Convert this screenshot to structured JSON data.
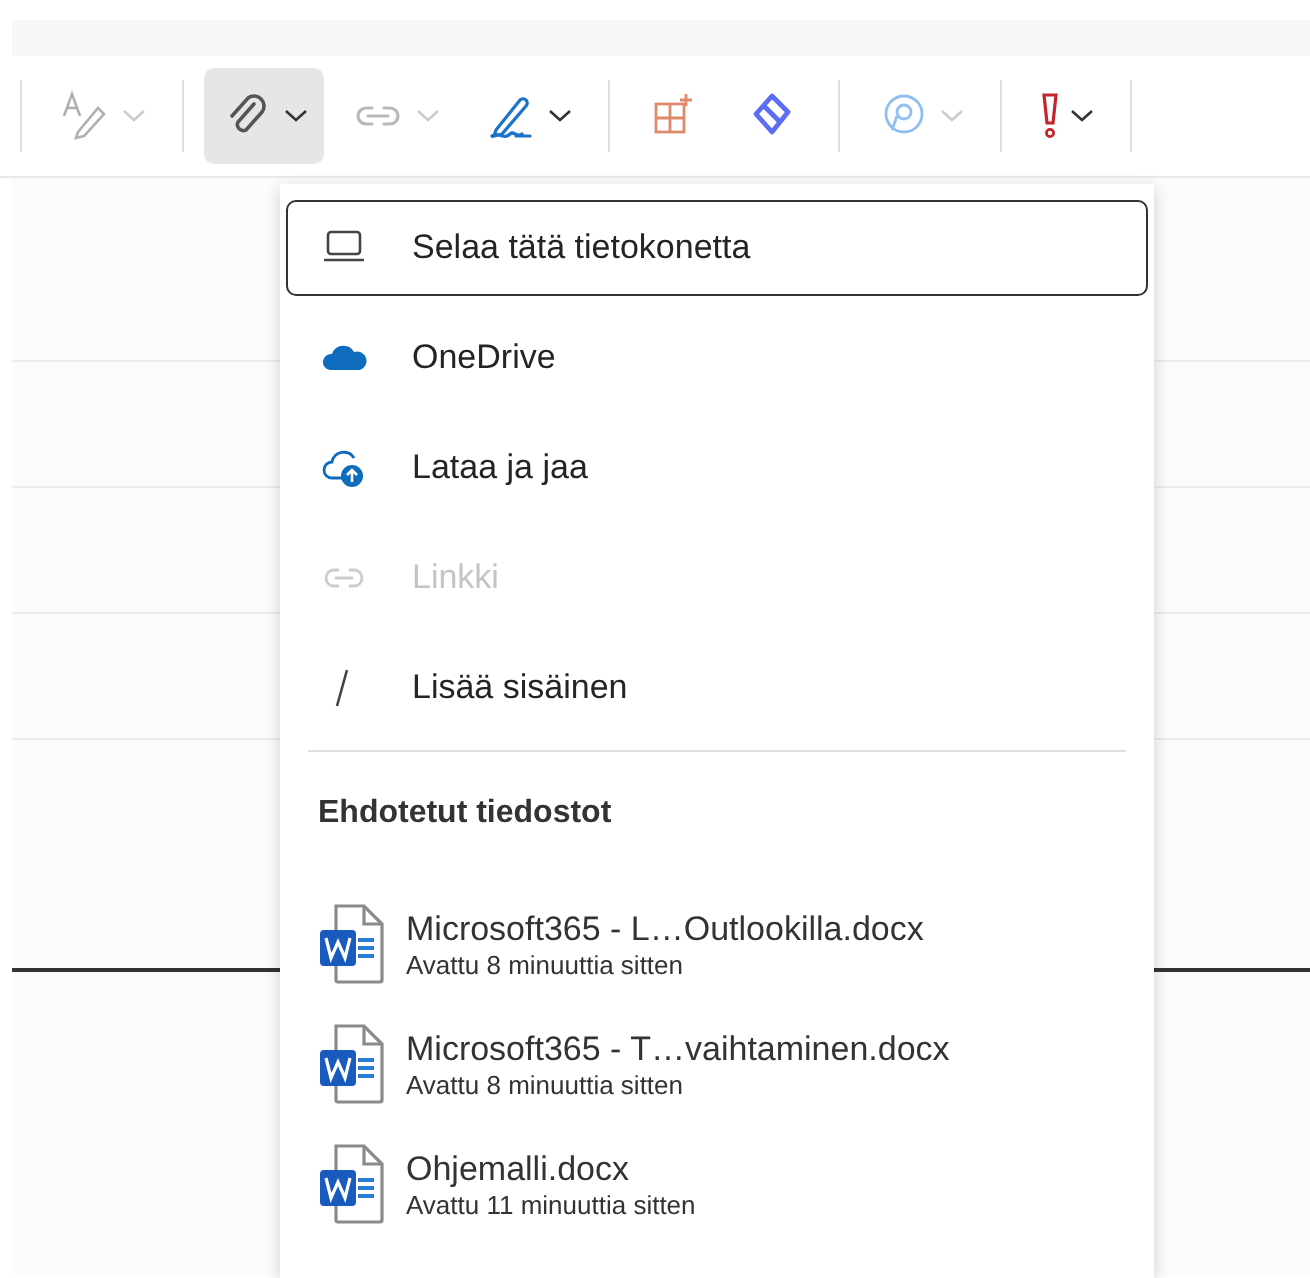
{
  "toolbar": {
    "buttons": [
      {
        "kind": "format",
        "selected": false,
        "disabled": true,
        "dropdown": true
      },
      {
        "kind": "attach",
        "selected": true,
        "disabled": false,
        "dropdown": true
      },
      {
        "kind": "link",
        "selected": false,
        "disabled": true,
        "dropdown": true
      },
      {
        "kind": "signature",
        "selected": false,
        "disabled": false,
        "dropdown": true
      },
      {
        "kind": "apps",
        "selected": false,
        "disabled": false,
        "dropdown": false
      },
      {
        "kind": "loop",
        "selected": false,
        "disabled": false,
        "dropdown": false
      },
      {
        "kind": "copilot",
        "selected": false,
        "disabled": true,
        "dropdown": true
      },
      {
        "kind": "importance",
        "selected": false,
        "disabled": false,
        "dropdown": true
      }
    ]
  },
  "attach_menu": {
    "items": [
      {
        "kind": "computer",
        "label": "Selaa tätä tietokonetta",
        "selected": true,
        "disabled": false
      },
      {
        "kind": "onedrive",
        "label": "OneDrive",
        "selected": false,
        "disabled": false
      },
      {
        "kind": "upload",
        "label": "Lataa ja jaa",
        "selected": false,
        "disabled": false
      },
      {
        "kind": "link",
        "label": "Linkki",
        "selected": false,
        "disabled": true
      },
      {
        "kind": "inline",
        "label": "Lisää sisäinen",
        "selected": false,
        "disabled": false
      }
    ],
    "section_title": "Ehdotetut tiedostot",
    "files": [
      {
        "name": "Microsoft365 - L…Outlookilla.docx",
        "opened": "Avattu 8 minuuttia sitten"
      },
      {
        "name": "Microsoft365 - T…vaihtaminen.docx",
        "opened": "Avattu 8 minuuttia sitten"
      },
      {
        "name": "Ohjemalli.docx",
        "opened": "Avattu 11 minuuttia sitten"
      }
    ]
  }
}
